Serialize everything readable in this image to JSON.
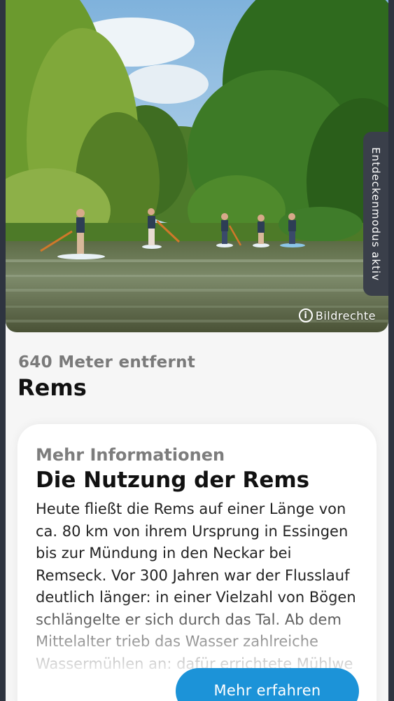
{
  "hero": {
    "credit_label": "Bildrechte",
    "credit_icon": "info-icon"
  },
  "discover_mode": {
    "label": "Entdeckenmodus aktiv"
  },
  "place": {
    "distance": "640 Meter entfernt",
    "title": "Rems"
  },
  "info_card": {
    "subtitle": "Mehr Informationen",
    "title": "Die Nutzung der Rems",
    "body": "Heute fließt die Rems auf einer Länge von ca. 80 km von ihrem Ursprung in Essingen bis zur Mündung in den Neckar bei Remseck. Vor 300 Jahren war der Flusslauf deutlich länger: in einer Vielzahl von Bögen schlängelte er sich durch das Tal. Ab dem Mittelalter trieb das Wasser zahlreiche Wassermühlen an: dafür errichtete Mühlwe"
  },
  "actions": {
    "more_label": "Mehr erfahren"
  },
  "colors": {
    "accent": "#1c93d8",
    "frame": "#2e3440",
    "tab": "#3a3f4a"
  }
}
